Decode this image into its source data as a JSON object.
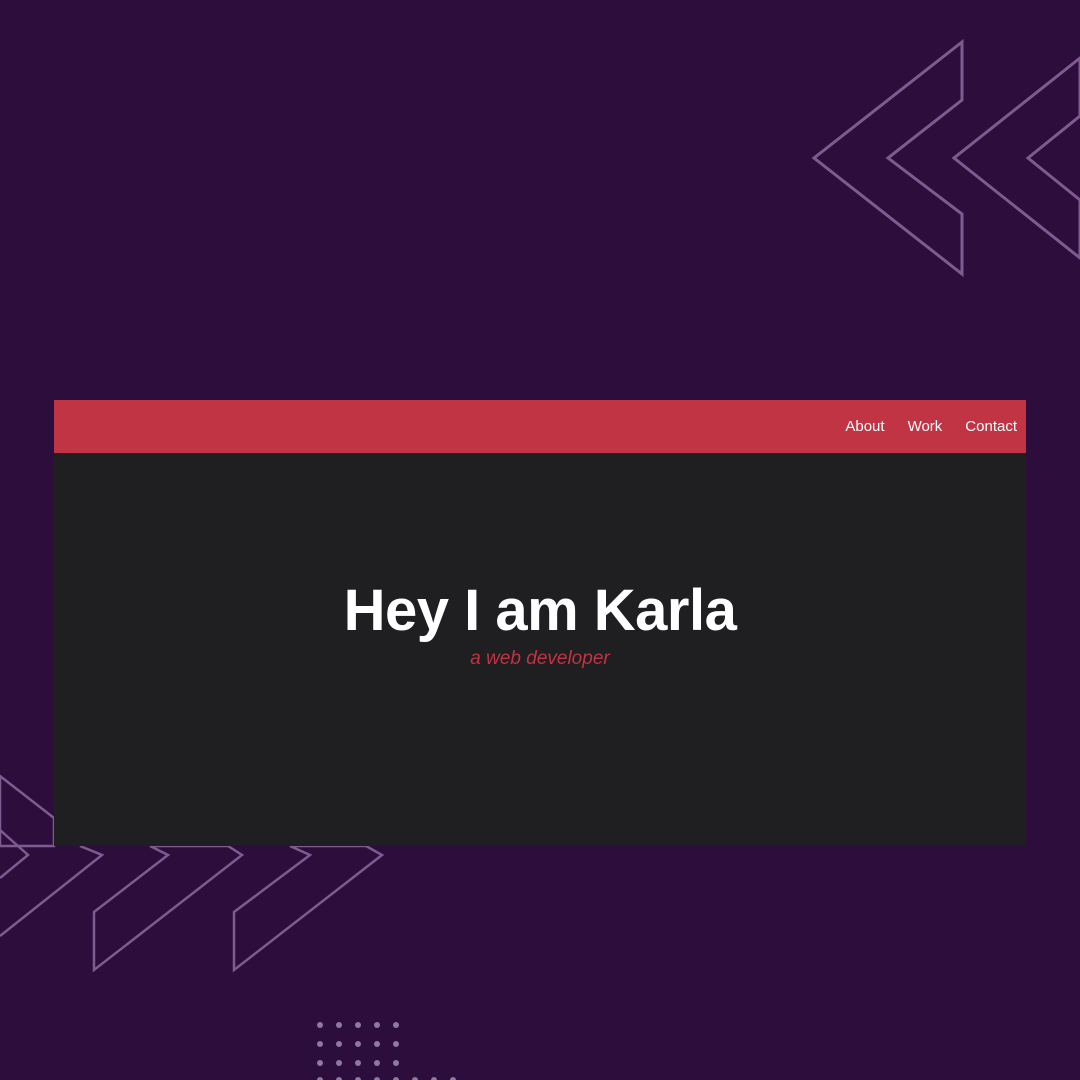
{
  "nav": {
    "links": [
      "About",
      "Work",
      "Contact"
    ]
  },
  "hero": {
    "title": "Hey I am Karla",
    "subtitle": "a web developer"
  },
  "colors": {
    "background": "#2d0d3c",
    "navbar": "#c03443",
    "site_body": "#1f1e21",
    "accent_text": "#c03443",
    "decoration": "#7e5a91"
  }
}
